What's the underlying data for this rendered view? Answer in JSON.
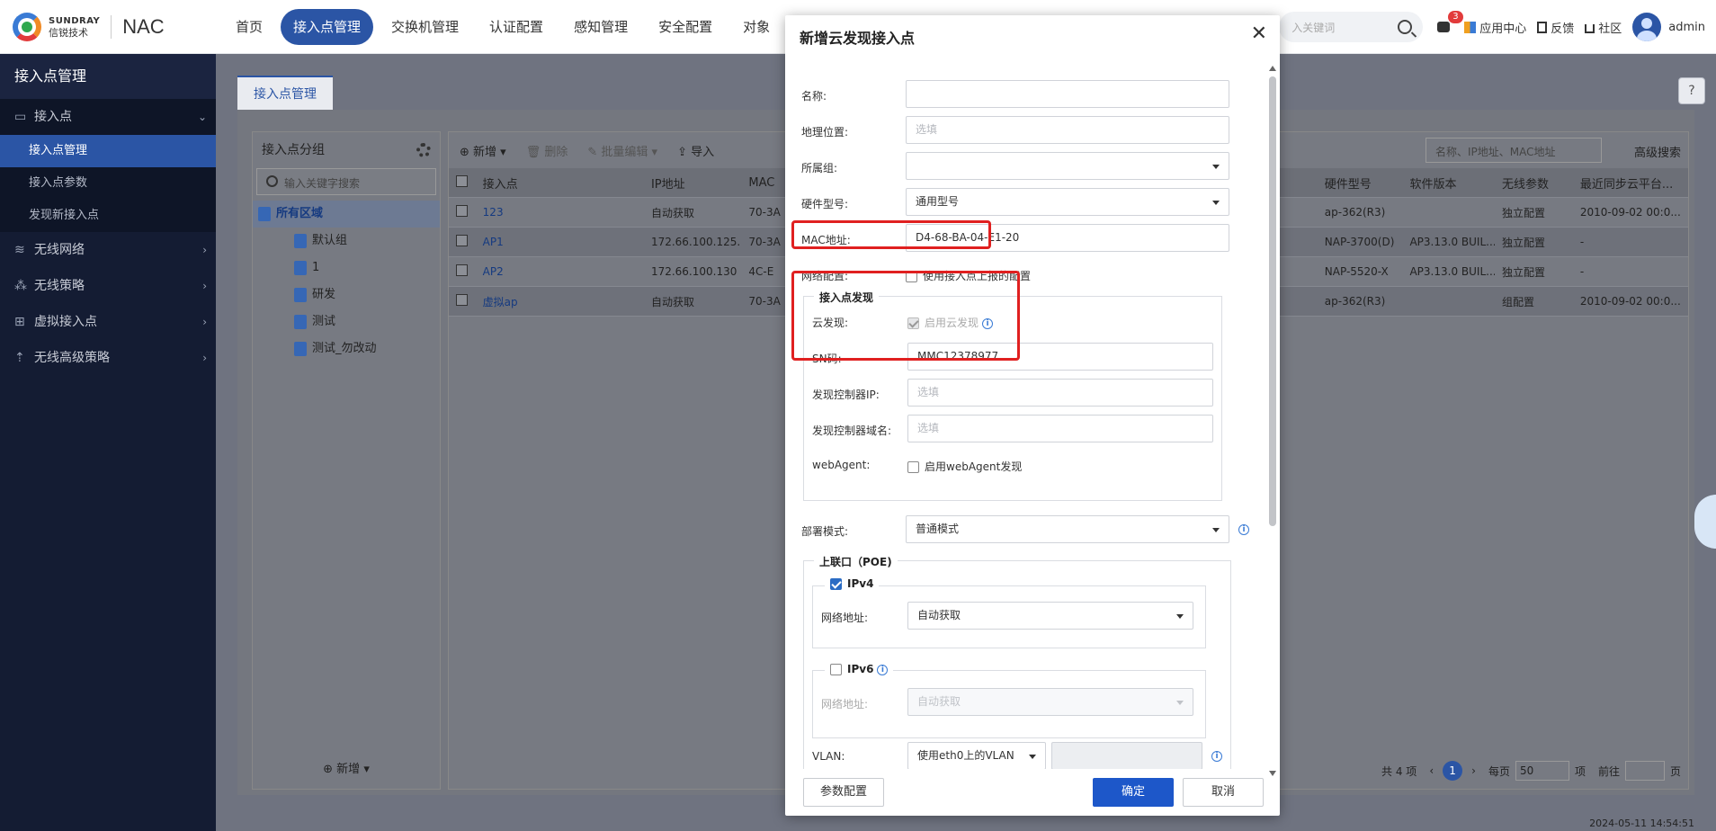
{
  "brand": {
    "en": "SUNDRAY",
    "cn": "信锐技术",
    "product": "NAC"
  },
  "nav": [
    "首页",
    "接入点管理",
    "交换机管理",
    "认证配置",
    "感知管理",
    "安全配置",
    "对象"
  ],
  "top": {
    "search_placeholder": "入关键词",
    "msg_count": "3",
    "app_center": "应用中心",
    "feedback": "反馈",
    "community": "社区",
    "user": "admin"
  },
  "sidebar": {
    "title": "接入点管理",
    "groups": [
      {
        "label": "接入点",
        "subs": [
          "接入点管理",
          "接入点参数",
          "发现新接入点"
        ]
      },
      {
        "label": "无线网络"
      },
      {
        "label": "无线策略"
      },
      {
        "label": "虚拟接入点"
      },
      {
        "label": "无线高级策略"
      }
    ]
  },
  "page": {
    "tab": "接入点管理",
    "help": "?",
    "left": {
      "title": "接入点分组",
      "search_placeholder": "输入关键字搜索",
      "root": "所有区域",
      "children": [
        "默认组",
        "1",
        "研发",
        "测试",
        "测试_勿改动"
      ],
      "add": "新增"
    },
    "toolbar": {
      "add": "新增",
      "delete": "删除",
      "bulk_edit": "批量编辑",
      "import": "导入",
      "search_placeholder": "名称、IP地址、MAC地址",
      "advanced": "高级搜索"
    },
    "table": {
      "headers": {
        "name": "接入点",
        "ip": "IP地址",
        "mac": "MAC",
        "hw": "硬件型号",
        "sw": "软件版本",
        "wl": "无线参数",
        "sync": "最近同步云平台..."
      },
      "rows": [
        {
          "name": "123",
          "ip": "自动获取",
          "mac": "70-3A",
          "hw": "ap-362(R3)",
          "sw": "",
          "wl": "独立配置",
          "sync": "2010-09-02 00:0..."
        },
        {
          "name": "AP1",
          "ip": "172.66.100.125...",
          "mac": "70-3A",
          "hw": "NAP-3700(D)",
          "sw": "AP3.13.0 BUIL...",
          "wl": "独立配置",
          "sync": "-"
        },
        {
          "name": "AP2",
          "ip": "172.66.100.130",
          "mac": "4C-E",
          "hw": "NAP-5520-X",
          "sw": "AP3.13.0 BUIL...",
          "wl": "独立配置",
          "sync": "-"
        },
        {
          "name": "虚拟ap",
          "ip": "自动获取",
          "mac": "70-3A",
          "hw": "ap-362(R3)",
          "sw": "",
          "wl": "组配置",
          "sync": "2010-09-02 00:0..."
        }
      ]
    },
    "pager": {
      "total": "共 4 项",
      "page": "1",
      "per_page_label": "每页",
      "per_page": "50",
      "unit": "项",
      "goto": "前往",
      "page_unit": "页"
    },
    "timestamp": "2024-05-11 14:54:51"
  },
  "modal": {
    "title": "新增云发现接入点",
    "name_label": "名称:",
    "name_value": "",
    "location_label": "地理位置:",
    "location_placeholder": "选填",
    "group_label": "所属组:",
    "group_value": "",
    "hw_label": "硬件型号:",
    "hw_value": "通用型号",
    "mac_label": "MAC地址:",
    "mac_value": "D4-68-BA-04-E1-20",
    "netcfg_label": "网络配置:",
    "netcfg_option": "使用接入点上报的配置",
    "discovery": {
      "legend": "接入点发现",
      "cloud_label": "云发现:",
      "cloud_option": "启用云发现",
      "sn_label": "SN码:",
      "sn_value": "MMC12378977",
      "ctrl_ip_label": "发现控制器IP:",
      "ctrl_ip_placeholder": "选填",
      "ctrl_domain_label": "发现控制器域名:",
      "ctrl_domain_placeholder": "选填",
      "webagent_label": "webAgent:",
      "webagent_option": "启用webAgent发现"
    },
    "deploy_label": "部署模式:",
    "deploy_value": "普通模式",
    "uplink": {
      "legend": "上联口（POE)",
      "ipv4": "IPv4",
      "ipv4_addr_label": "网络地址:",
      "ipv4_addr_value": "自动获取",
      "ipv6": "IPv6",
      "ipv6_addr_label": "网络地址:",
      "ipv6_addr_value": "自动获取",
      "vlan_label": "VLAN:",
      "vlan_value": "使用eth0上的VLAN"
    },
    "footer": {
      "params": "参数配置",
      "ok": "确定",
      "cancel": "取消"
    }
  },
  "colors": {
    "accent": "#2b55a5",
    "highlight": "#e02020",
    "primary_button": "#1d57c9"
  }
}
